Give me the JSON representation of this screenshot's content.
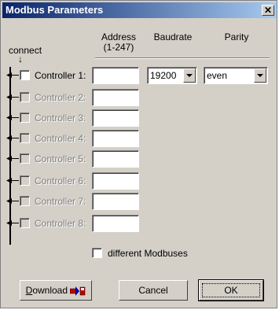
{
  "window": {
    "title": "Modbus Parameters"
  },
  "headers": {
    "connect": "connect",
    "connect_arrow": "↓",
    "address": "Address",
    "address_range": "(1-247)",
    "baudrate": "Baudrate",
    "parity": "Parity"
  },
  "controllers": [
    {
      "label": "Controller 1:",
      "enabled": true,
      "checked": false,
      "address": "",
      "baudrate": "19200",
      "parity": "even"
    },
    {
      "label": "Controller 2:",
      "enabled": false,
      "checked": false,
      "address": ""
    },
    {
      "label": "Controller 3:",
      "enabled": false,
      "checked": false,
      "address": ""
    },
    {
      "label": "Controller 4:",
      "enabled": false,
      "checked": false,
      "address": ""
    },
    {
      "label": "Controller 5:",
      "enabled": false,
      "checked": false,
      "address": ""
    },
    {
      "label": "Controller 6:",
      "enabled": false,
      "checked": false,
      "address": ""
    },
    {
      "label": "Controller 7:",
      "enabled": false,
      "checked": false,
      "address": ""
    },
    {
      "label": "Controller 8:",
      "enabled": false,
      "checked": false,
      "address": ""
    }
  ],
  "different_modbuses": {
    "label": "different Modbuses",
    "checked": false
  },
  "buttons": {
    "download": "Download",
    "download_mnemonic": "D",
    "download_rest": "ownload",
    "cancel": "Cancel",
    "ok": "OK"
  },
  "colors": {
    "titlebar_start": "#0a246a",
    "titlebar_end": "#a6caf0",
    "face": "#d4d0c8"
  }
}
